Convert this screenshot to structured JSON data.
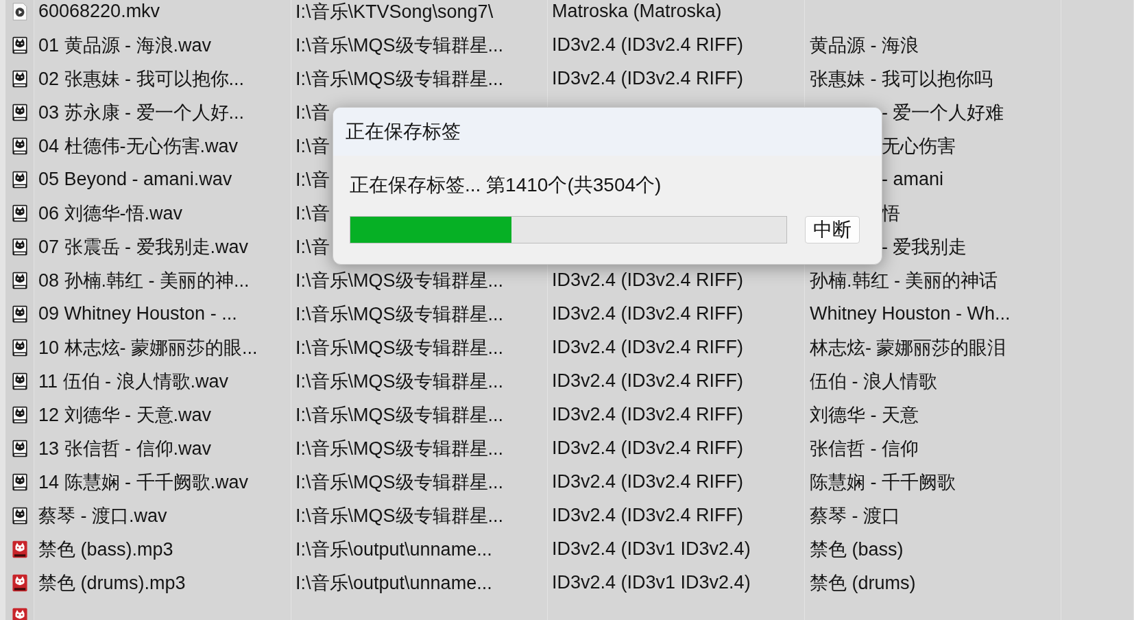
{
  "file_list": {
    "rows": [
      {
        "kind": "mkv",
        "filename": "60068220.mkv",
        "path": "I:\\音乐\\KTVSong\\song7\\",
        "tag": "Matroska (Matroska)"
      },
      {
        "kind": "wav",
        "filename": "01 黄品源 - 海浪.wav",
        "path": "I:\\音乐\\MQS级专辑群星...",
        "tag": "ID3v2.4 (ID3v2.4 RIFF)",
        "title": "黄品源 - 海浪"
      },
      {
        "kind": "wav",
        "filename": "02 张惠妹 - 我可以抱你...",
        "path": "I:\\音乐\\MQS级专辑群星...",
        "tag": "ID3v2.4 (ID3v2.4 RIFF)",
        "title": "张惠妹 - 我可以抱你吗"
      },
      {
        "kind": "wav",
        "filename": "03 苏永康 - 爱一个人好...",
        "path": "I:\\音",
        "title": "- 爱一个人好难"
      },
      {
        "kind": "wav",
        "filename": "04 杜德伟-无心伤害.wav",
        "path": "I:\\音",
        "title": "无心伤害"
      },
      {
        "kind": "wav",
        "filename": "05 Beyond - amani.wav",
        "path": "I:\\音",
        "title": "- amani"
      },
      {
        "kind": "wav",
        "filename": "06 刘德华-悟.wav",
        "path": "I:\\音",
        "title": "悟"
      },
      {
        "kind": "wav",
        "filename": "07 张震岳 - 爱我别走.wav",
        "path": "I:\\音",
        "title": "- 爱我别走"
      },
      {
        "kind": "wav",
        "filename": "08 孙楠.韩红 - 美丽的神...",
        "path": "I:\\音乐\\MQS级专辑群星...",
        "tag": "ID3v2.4 (ID3v2.4 RIFF)",
        "title": "孙楠.韩红 - 美丽的神话"
      },
      {
        "kind": "wav",
        "filename": "09 Whitney Houston - ...",
        "path": "I:\\音乐\\MQS级专辑群星...",
        "tag": "ID3v2.4 (ID3v2.4 RIFF)",
        "title": "Whitney Houston - Wh..."
      },
      {
        "kind": "wav",
        "filename": "10 林志炫- 蒙娜丽莎的眼...",
        "path": "I:\\音乐\\MQS级专辑群星...",
        "tag": "ID3v2.4 (ID3v2.4 RIFF)",
        "title": "林志炫- 蒙娜丽莎的眼泪"
      },
      {
        "kind": "wav",
        "filename": "11 伍伯 - 浪人情歌.wav",
        "path": "I:\\音乐\\MQS级专辑群星...",
        "tag": "ID3v2.4 (ID3v2.4 RIFF)",
        "title": "伍伯 - 浪人情歌"
      },
      {
        "kind": "wav",
        "filename": "12 刘德华 - 天意.wav",
        "path": "I:\\音乐\\MQS级专辑群星...",
        "tag": "ID3v2.4 (ID3v2.4 RIFF)",
        "title": "刘德华 - 天意"
      },
      {
        "kind": "wav",
        "filename": "13 张信哲 - 信仰.wav",
        "path": "I:\\音乐\\MQS级专辑群星...",
        "tag": "ID3v2.4 (ID3v2.4 RIFF)",
        "title": "张信哲 - 信仰"
      },
      {
        "kind": "wav",
        "filename": "14 陈慧娴 - 千千阙歌.wav",
        "path": "I:\\音乐\\MQS级专辑群星...",
        "tag": "ID3v2.4 (ID3v2.4 RIFF)",
        "title": "陈慧娴 - 千千阙歌"
      },
      {
        "kind": "wav",
        "filename": "蔡琴 - 渡口.wav",
        "path": "I:\\音乐\\MQS级专辑群星...",
        "tag": "ID3v2.4 (ID3v2.4 RIFF)",
        "title": "蔡琴 - 渡口"
      },
      {
        "kind": "mp3",
        "filename": "禁色 (bass).mp3",
        "path": "I:\\音乐\\output\\unname...",
        "tag": "ID3v2.4 (ID3v1 ID3v2.4)",
        "title": "禁色 (bass)"
      },
      {
        "kind": "mp3",
        "filename": "禁色 (drums).mp3",
        "path": "I:\\音乐\\output\\unname...",
        "tag": "ID3v2.4 (ID3v1 ID3v2.4)",
        "title": "禁色 (drums)"
      },
      {
        "kind": "mp3"
      }
    ]
  },
  "dialog": {
    "title": "正在保存标签",
    "message": "正在保存标签... 第1410个(共3504个)",
    "progress": {
      "level": 0.37
    },
    "button": "中断"
  }
}
